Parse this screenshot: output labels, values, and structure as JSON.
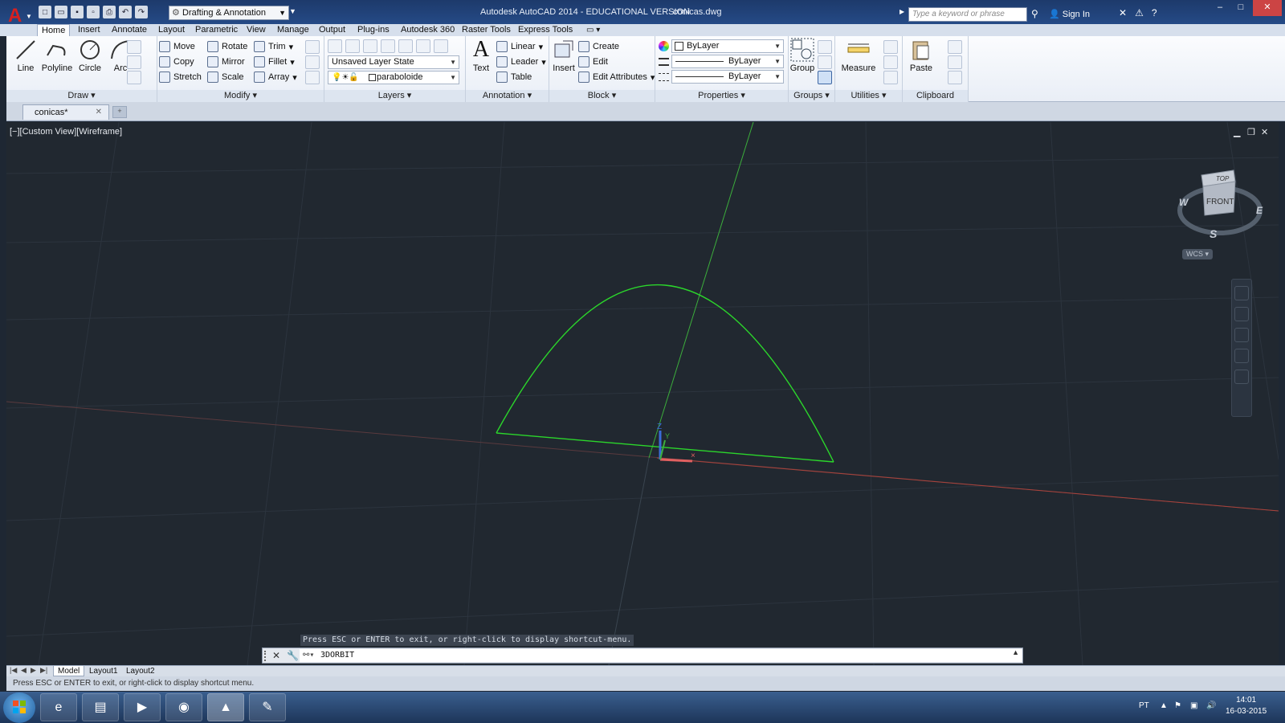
{
  "titlebar": {
    "workspace": "Drafting & Annotation",
    "title": "Autodesk AutoCAD 2014 - EDUCATIONAL VERSION",
    "filename": "conicas.dwg",
    "search_placeholder": "Type a keyword or phrase",
    "signin": "Sign In"
  },
  "tabs": [
    "Home",
    "Insert",
    "Annotate",
    "Layout",
    "Parametric",
    "View",
    "Manage",
    "Output",
    "Plug-ins",
    "Autodesk 360",
    "Raster Tools",
    "Express Tools"
  ],
  "ribbon": {
    "draw": {
      "title": "Draw",
      "line": "Line",
      "polyline": "Polyline",
      "circle": "Circle",
      "arc": "Arc"
    },
    "modify": {
      "title": "Modify",
      "move": "Move",
      "rotate": "Rotate",
      "trim": "Trim",
      "copy": "Copy",
      "mirror": "Mirror",
      "fillet": "Fillet",
      "stretch": "Stretch",
      "scale": "Scale",
      "array": "Array"
    },
    "layers": {
      "title": "Layers",
      "layer_state": "Unsaved Layer State",
      "current_layer": "paraboloide"
    },
    "annotation": {
      "title": "Annotation",
      "text": "Text",
      "linear": "Linear",
      "leader": "Leader",
      "table": "Table"
    },
    "block": {
      "title": "Block",
      "insert": "Insert",
      "create": "Create",
      "edit": "Edit",
      "edit_attributes": "Edit Attributes"
    },
    "properties": {
      "title": "Properties",
      "color": "ByLayer",
      "lineweight": "ByLayer",
      "linetype": "ByLayer"
    },
    "groups": {
      "title": "Groups",
      "group": "Group"
    },
    "utilities": {
      "title": "Utilities",
      "measure": "Measure"
    },
    "clipboard": {
      "title": "Clipboard",
      "paste": "Paste"
    }
  },
  "doc_tab": "conicas*",
  "viewport": {
    "label": "[−][Custom View][Wireframe]",
    "viewcube": {
      "top": "TOP",
      "front": "FRONT",
      "w": "W",
      "e": "E",
      "s": "S"
    },
    "wcs": "WCS",
    "ucs_z": "Z",
    "ucs_y": "Y"
  },
  "command": {
    "history": "Press ESC or ENTER to exit, or right-click to display shortcut-menu.",
    "current": "3DORBIT"
  },
  "layout_tabs": [
    "Model",
    "Layout1",
    "Layout2"
  ],
  "status": "Press ESC or ENTER to exit, or right-click to display shortcut menu.",
  "taskbar": {
    "lang": "PT",
    "time": "14:01",
    "date": "16-03-2015"
  },
  "colors": {
    "curve": "#2bd62b",
    "x_axis": "#c8443a",
    "y_axis": "#3cae3c",
    "background": "#212830"
  }
}
